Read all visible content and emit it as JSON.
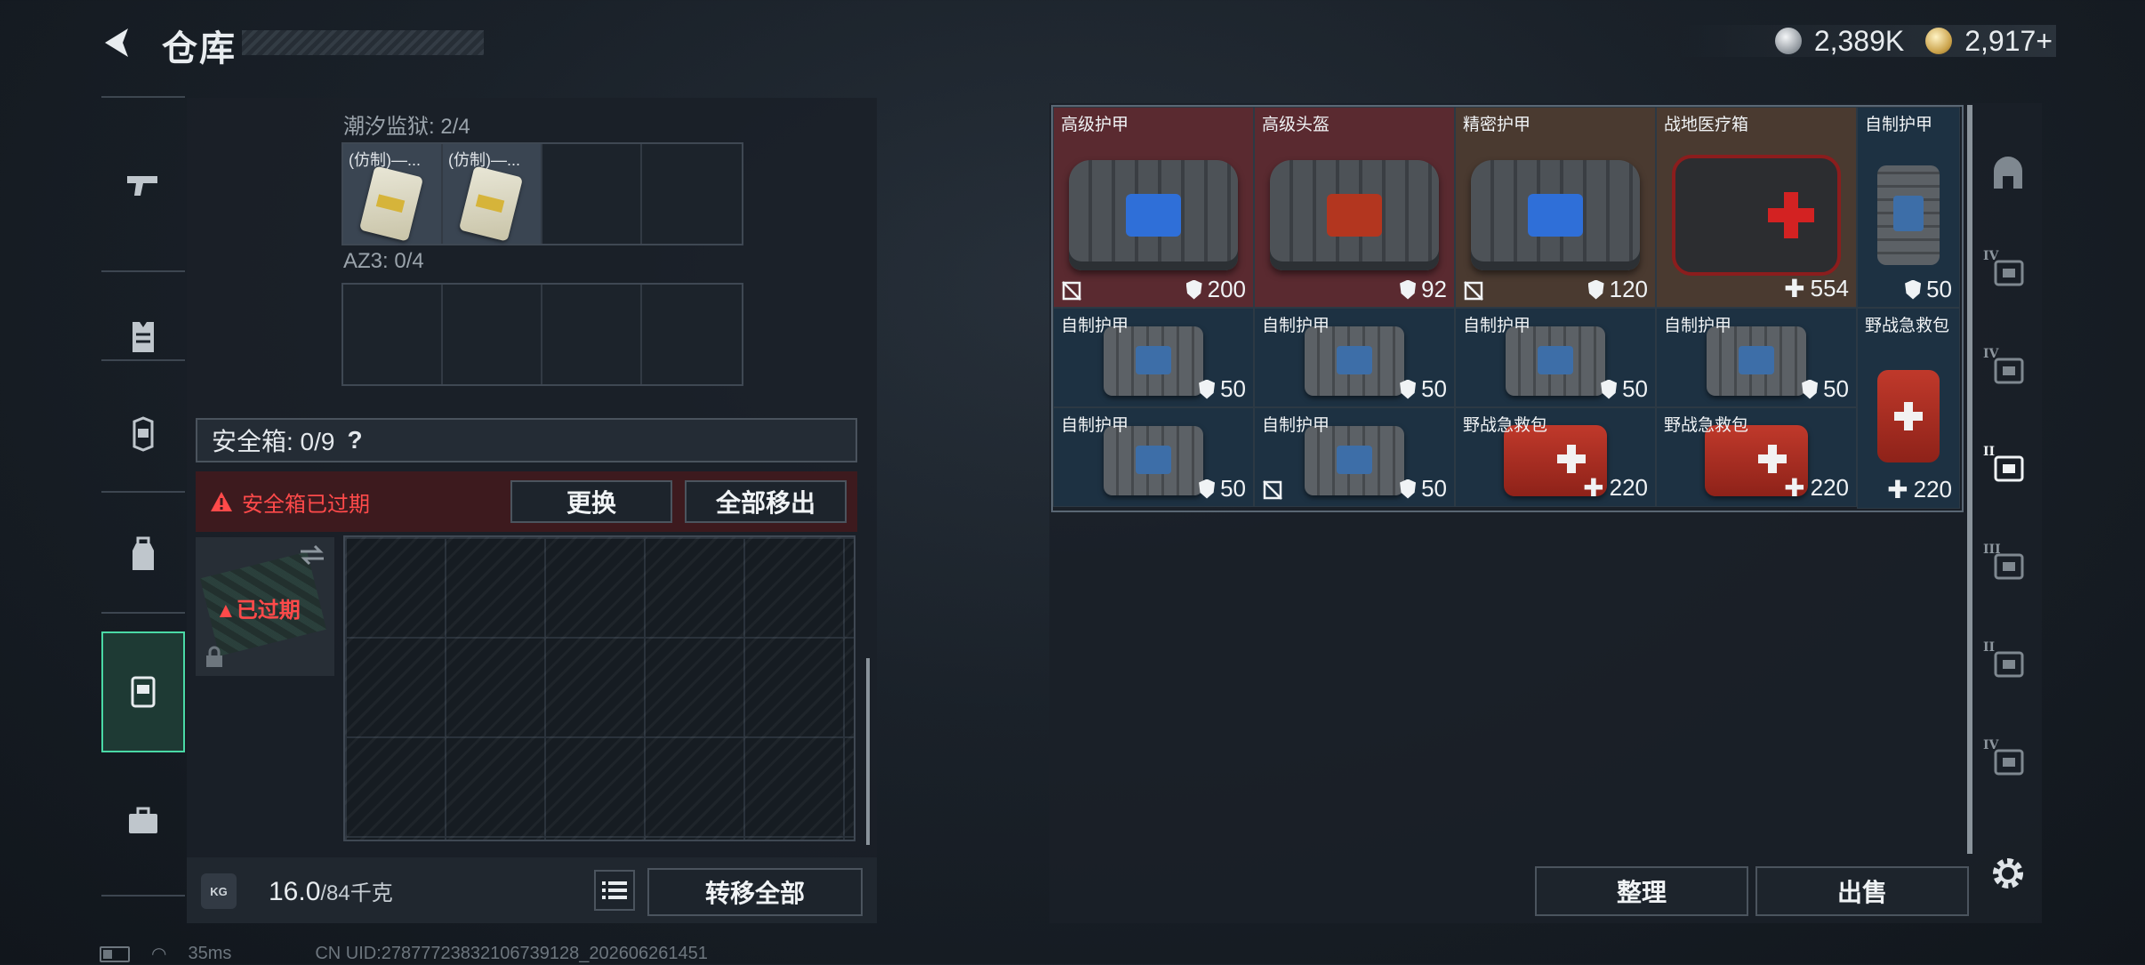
{
  "header": {
    "title": "仓库"
  },
  "currency": {
    "silver": "2,389K",
    "gold": "2,917+"
  },
  "left_panel": {
    "section1": {
      "label": "潮汐监狱: 2/4",
      "items": [
        {
          "name": "(仿制)—..."
        },
        {
          "name": "(仿制)—..."
        }
      ]
    },
    "section2": {
      "label": "AZ3: 0/4"
    },
    "safe_box": {
      "label": "安全箱: 0/9",
      "help": "?",
      "expired_warning": "安全箱已过期",
      "replace_button": "更换",
      "remove_all_button": "全部移出",
      "item_status": "已过期"
    },
    "footer": {
      "weight_icon": "KG",
      "weight_current": "16.0",
      "weight_max": "/84千克",
      "transfer_all_button": "转移全部"
    }
  },
  "right_panel": {
    "items": [
      {
        "name": "高级护甲",
        "value": "200",
        "stat": "shield",
        "no_trade": true,
        "bg": "#5a2a30",
        "kind": "bag-big",
        "accent": "#2f6fd8"
      },
      {
        "name": "高级头盔",
        "value": "92",
        "stat": "shield",
        "no_trade": false,
        "bg": "#5a2a30",
        "kind": "bag-big",
        "accent": "#b3361f"
      },
      {
        "name": "精密护甲",
        "value": "120",
        "stat": "shield",
        "no_trade": true,
        "bg": "#4a3a30",
        "kind": "bag-big",
        "accent": "#2f6fd8"
      },
      {
        "name": "战地医疗箱",
        "value": "554",
        "stat": "heal",
        "no_trade": false,
        "bg": "#4a3a30",
        "kind": "medkit-big"
      },
      {
        "name": "自制护甲",
        "value": "50",
        "stat": "shield",
        "no_trade": false,
        "bg": "#1d3142",
        "kind": "vest-tall"
      },
      {
        "name": "自制护甲",
        "value": "50",
        "stat": "shield",
        "no_trade": false,
        "bg": "#1d3142",
        "kind": "bag-small"
      },
      {
        "name": "自制护甲",
        "value": "50",
        "stat": "shield",
        "no_trade": false,
        "bg": "#1d3142",
        "kind": "bag-small"
      },
      {
        "name": "自制护甲",
        "value": "50",
        "stat": "shield",
        "no_trade": false,
        "bg": "#1d3142",
        "kind": "bag-small"
      },
      {
        "name": "自制护甲",
        "value": "50",
        "stat": "shield",
        "no_trade": false,
        "bg": "#1d3142",
        "kind": "bag-small"
      },
      {
        "name": "野战急救包",
        "value": "220",
        "stat": "heal",
        "no_trade": false,
        "bg": "#1d3142",
        "kind": "medkit-tall"
      },
      {
        "name": "自制护甲",
        "value": "50",
        "stat": "shield",
        "no_trade": false,
        "bg": "#1d3142",
        "kind": "bag-small"
      },
      {
        "name": "自制护甲",
        "value": "50",
        "stat": "shield",
        "no_trade": true,
        "bg": "#1d3142",
        "kind": "bag-small"
      },
      {
        "name": "野战急救包",
        "value": "220",
        "stat": "heal",
        "no_trade": false,
        "bg": "#1d3142",
        "kind": "medkit-small"
      },
      {
        "name": "野战急救包",
        "value": "220",
        "stat": "heal",
        "no_trade": false,
        "bg": "#1d3142",
        "kind": "medkit-small"
      }
    ],
    "sort_button": "整理",
    "sell_button": "出售"
  },
  "right_nav": [
    {
      "icon": "helmet-icon",
      "tier": ""
    },
    {
      "icon": "filter-tier4-armor-icon",
      "tier": "IV"
    },
    {
      "icon": "filter-tier4-rig-icon",
      "tier": "IV"
    },
    {
      "icon": "filter-tier2-medkit-icon",
      "tier": "II"
    },
    {
      "icon": "filter-tier3-backpack-icon",
      "tier": "III"
    },
    {
      "icon": "filter-tier2-tool-icon",
      "tier": "II"
    },
    {
      "icon": "filter-tier4-misc-icon",
      "tier": "IV"
    }
  ],
  "status_bar": {
    "ping": "35ms",
    "uid": "CN UID:2787772383210673912­8_202606261451"
  }
}
